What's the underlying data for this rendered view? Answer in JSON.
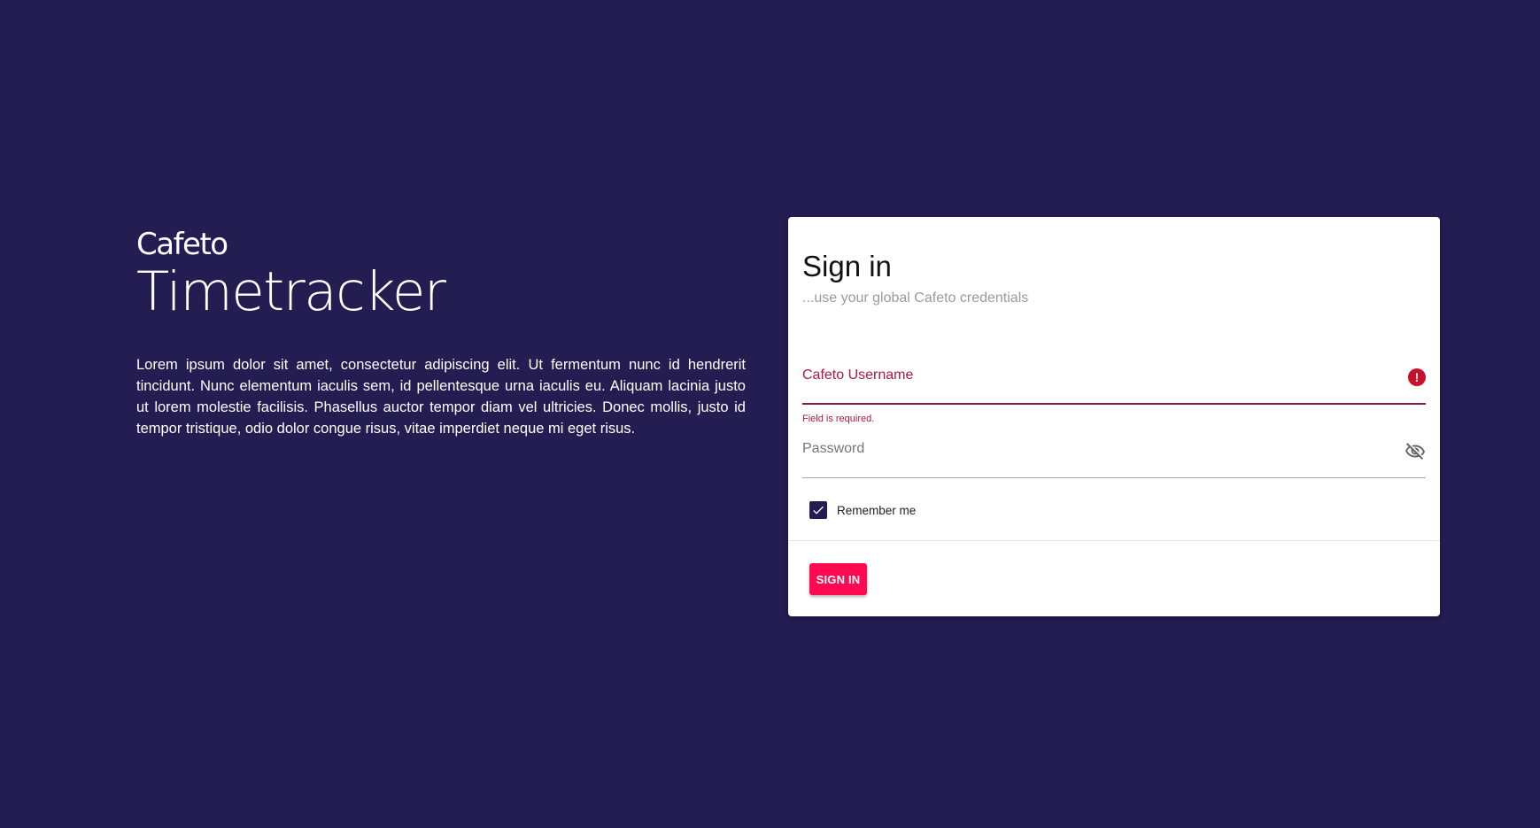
{
  "brand": {
    "logo": "Cafeto",
    "title": "Timetracker",
    "description": "Lorem ipsum dolor sit amet, consectetur adipiscing elit. Ut fermentum nunc id hendrerit tincidunt. Nunc elementum iaculis sem, id pellentesque urna iaculis eu. Aliquam lacinia justo ut lorem molestie facilisis. Phasellus auctor tempor diam vel ultricies. Donec mollis, justo id tempor tristique, odio dolor congue risus, vitae imperdiet neque mi eget risus."
  },
  "signin": {
    "title": "Sign in",
    "subtitle": "...use your global Cafeto credentials",
    "username": {
      "label": "Cafeto Username",
      "value": "",
      "error": "Field is required.",
      "icon": "error-icon"
    },
    "password": {
      "label": "Password",
      "value": "",
      "icon": "visibility-off-icon"
    },
    "remember": {
      "label": "Remember me",
      "checked": true
    },
    "button_label": "SIGN IN"
  },
  "colors": {
    "background": "#231d52",
    "accent": "#ff0a50",
    "error": "#b0183c",
    "card": "#ffffff"
  }
}
